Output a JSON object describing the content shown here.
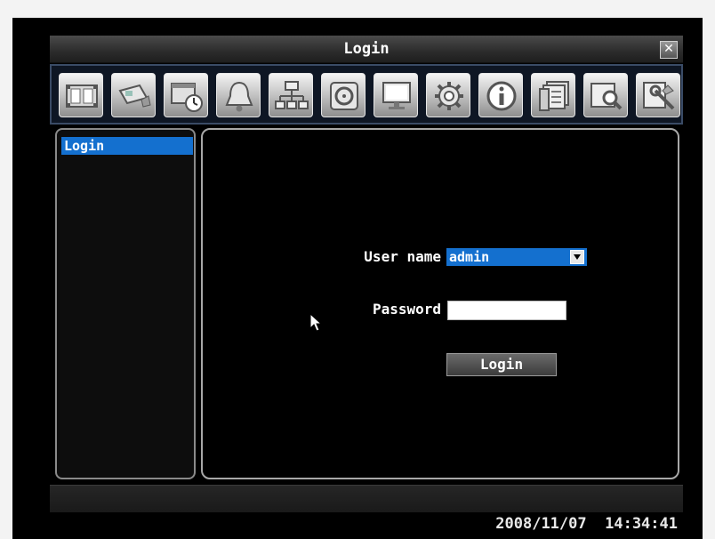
{
  "window": {
    "title": "Login",
    "close_icon": "close-icon"
  },
  "toolbar": {
    "buttons": [
      {
        "icon": "record-film-icon"
      },
      {
        "icon": "camera-icon"
      },
      {
        "icon": "schedule-recording-icon"
      },
      {
        "icon": "alarm-bell-icon"
      },
      {
        "icon": "network-icon"
      },
      {
        "icon": "backup-disk-icon"
      },
      {
        "icon": "display-monitor-icon"
      },
      {
        "icon": "system-gear-icon"
      },
      {
        "icon": "info-icon"
      },
      {
        "icon": "event-log-icon"
      },
      {
        "icon": "search-icon"
      },
      {
        "icon": "tools-icon"
      }
    ]
  },
  "sidebar": {
    "items": [
      {
        "label": "Login",
        "selected": true
      }
    ]
  },
  "form": {
    "user_label": "User name",
    "user_value": "admin",
    "password_label": "Password",
    "password_value": "",
    "login_button": "Login"
  },
  "status": {
    "date": "2008/11/07",
    "time": "14:34:41"
  },
  "colors": {
    "accent": "#1470cf",
    "background": "#000000",
    "border": "#a8a8a8"
  }
}
